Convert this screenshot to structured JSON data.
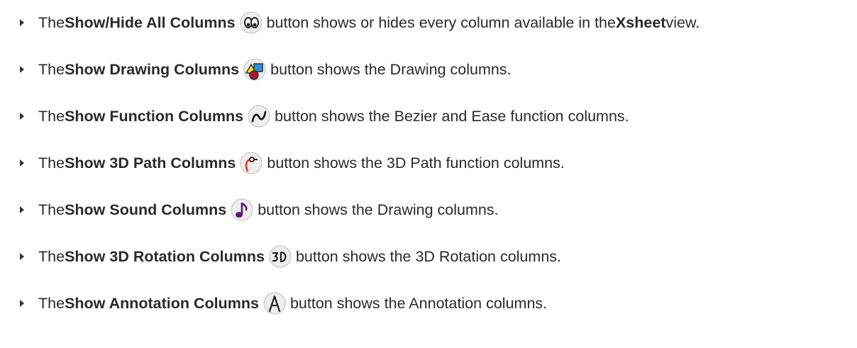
{
  "items": [
    {
      "pre": "The ",
      "label": "Show/Hide All Columns",
      "icon": "eyes-icon",
      "post": " button shows or hides every column available in the ",
      "post_bold": "Xsheet",
      "post_end": " view."
    },
    {
      "pre": "The ",
      "label": "Show Drawing Columns",
      "icon": "shapes-icon",
      "post": " button shows the Drawing columns.",
      "post_bold": "",
      "post_end": ""
    },
    {
      "pre": "The ",
      "label": "Show Function Columns",
      "icon": "wave-icon",
      "post": " button shows the Bezier and Ease function columns.",
      "post_bold": "",
      "post_end": ""
    },
    {
      "pre": "The ",
      "label": "Show 3D Path Columns",
      "icon": "path-icon",
      "post": " button shows the 3D Path function columns.",
      "post_bold": "",
      "post_end": ""
    },
    {
      "pre": "The ",
      "label": "Show Sound Columns",
      "icon": "music-note-icon",
      "post": " button shows the Drawing columns.",
      "post_bold": "",
      "post_end": ""
    },
    {
      "pre": "The ",
      "label": "Show 3D Rotation Columns",
      "icon": "3d-icon",
      "post": " button shows the 3D Rotation columns.",
      "post_bold": "",
      "post_end": ""
    },
    {
      "pre": "The ",
      "label": "Show Annotation Columns",
      "icon": "annotation-a-icon",
      "post": " button shows the Annotation columns.",
      "post_bold": "",
      "post_end": ""
    }
  ],
  "colors": {
    "text": "#2a2a2a",
    "icon_bg": "#ececec",
    "note": "#5a1a6e",
    "path_red": "#e03a2f"
  }
}
